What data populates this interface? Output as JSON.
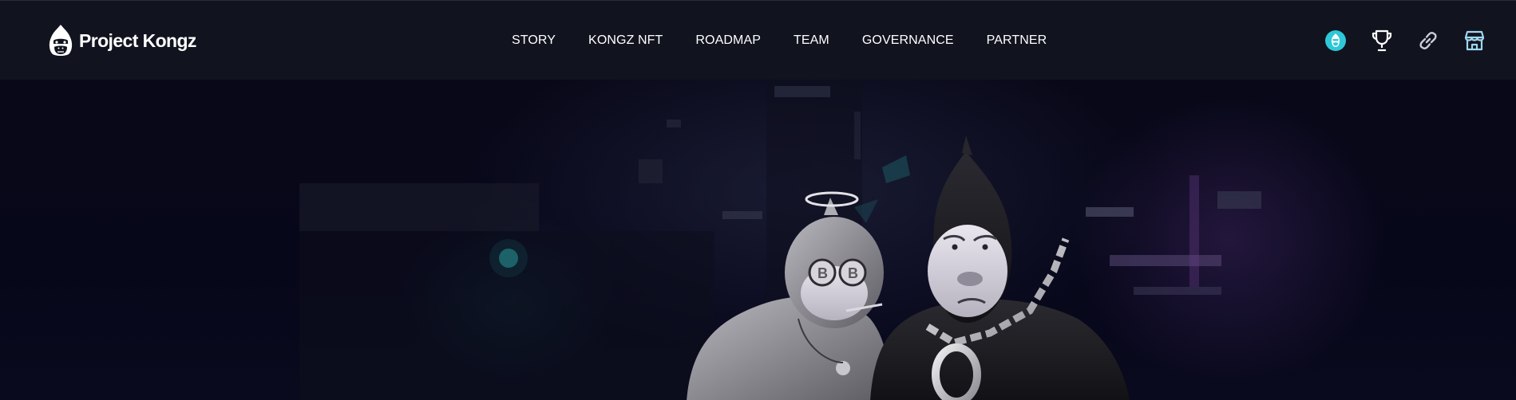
{
  "brand": {
    "name": "Project Kongz",
    "logo_icon": "gorilla-head-icon"
  },
  "nav": {
    "items": [
      {
        "label": "STORY"
      },
      {
        "label": "KONGZ NFT"
      },
      {
        "label": "ROADMAP"
      },
      {
        "label": "TEAM"
      },
      {
        "label": "GOVERNANCE"
      },
      {
        "label": "PARTNER"
      }
    ],
    "icons": [
      "kongz-token-icon",
      "trophy-icon",
      "link-icon",
      "store-icon"
    ]
  },
  "hero": {
    "illustration": "two-gorillas-bitcoin-glasses-chain-icon"
  },
  "colors": {
    "nav_background": "#11131f",
    "hero_background": "#070716",
    "accent_cyan": "#2ec8d6",
    "icon_light_blue": "#9fd6ef",
    "text": "#ffffff"
  }
}
